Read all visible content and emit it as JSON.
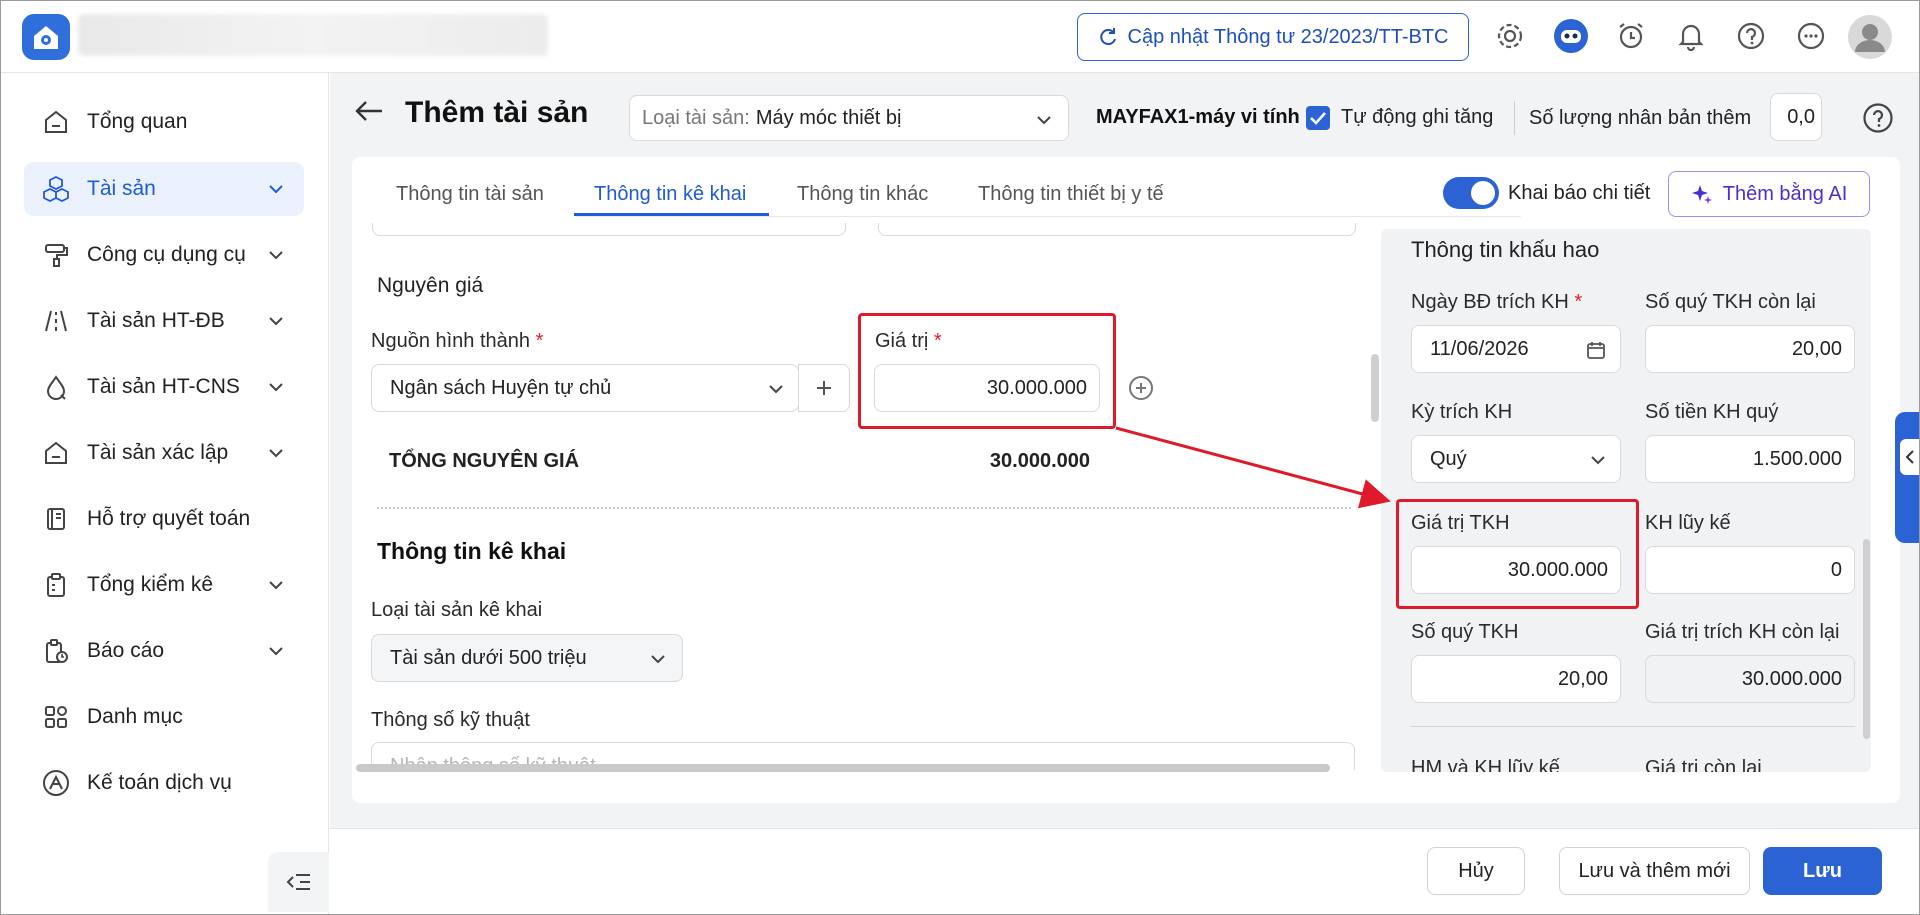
{
  "topbar": {
    "update_button": "Cập nhật Thông tư 23/2023/TT-BTC",
    "icons": [
      "settings-icon",
      "assistant-bot-icon",
      "alarm-icon",
      "bell-icon",
      "help-icon",
      "more-icon",
      "avatar"
    ]
  },
  "sidebar": {
    "items": [
      {
        "label": "Tổng quan",
        "icon": "home-icon"
      },
      {
        "label": "Tài sản",
        "icon": "cubes-icon"
      },
      {
        "label": "Công cụ dụng cụ",
        "icon": "paint-roller-icon"
      },
      {
        "label": "Tài sản HT-ĐB",
        "icon": "road-icon"
      },
      {
        "label": "Tài sản HT-CNS",
        "icon": "water-drop-icon"
      },
      {
        "label": "Tài sản xác lập",
        "icon": "home-outline-icon"
      },
      {
        "label": "Hỗ trợ quyết toán",
        "icon": "book-icon"
      },
      {
        "label": "Tổng kiểm kê",
        "icon": "clipboard-icon"
      },
      {
        "label": "Báo cáo",
        "icon": "report-icon"
      },
      {
        "label": "Danh mục",
        "icon": "grid-icon"
      },
      {
        "label": "Kế toán dịch vụ",
        "icon": "accounting-icon"
      }
    ]
  },
  "header": {
    "title": "Thêm tài sản",
    "asset_type_label": "Loại tài sản:",
    "asset_type_value": "Máy móc thiết bị",
    "asset_code": "MAYFAX1-máy vi tính",
    "auto_increase": "Tự động ghi tăng",
    "duplicate_label": "Số lượng nhân bản thêm",
    "duplicate_value": "0,0"
  },
  "tabs": [
    "Thông tin tài sản",
    "Thông tin kê khai",
    "Thông tin khác",
    "Thông tin thiết bị y tế"
  ],
  "detail_toggle_label": "Khai báo chi tiết",
  "ai_button": "Thêm bằng AI",
  "original_cost": {
    "section_title": "Nguyên giá",
    "source_label": "Nguồn hình thành",
    "source_value": "Ngân sách Huyện tự chủ",
    "value_label": "Giá trị",
    "value": "30.000.000",
    "total_label": "TỔNG NGUYÊN GIÁ",
    "total_value": "30.000.000"
  },
  "declaration": {
    "section_title": "Thông tin kê khai",
    "type_label": "Loại tài sản kê khai",
    "type_value": "Tài sản dưới 500 triệu",
    "spec_label": "Thông số kỹ thuật",
    "spec_placeholder": "Nhập thông số kỹ thuật"
  },
  "depreciation": {
    "title": "Thông tin khấu hao",
    "start_date_label": "Ngày BĐ trích KH",
    "start_date": "11/06/2026",
    "remaining_quarters_label": "Số quý TKH còn lại",
    "remaining_quarters": "20,00",
    "period_label": "Kỳ trích KH",
    "period_value": "Quý",
    "quarter_amount_label": "Số tiền KH quý",
    "quarter_amount": "1.500.000",
    "dep_value_label": "Giá trị TKH",
    "dep_value": "30.000.000",
    "accumulated_label": "KH lũy kế",
    "accumulated": "0",
    "quarters_label": "Số quý TKH",
    "quarters": "20,00",
    "remaining_value_label": "Giá trị trích KH còn lại",
    "remaining_value": "30.000.000",
    "hm_label": "HM và KH lũy kế",
    "residual_label": "Giá trị còn lại"
  },
  "footer": {
    "cancel": "Hủy",
    "save_new": "Lưu và thêm mới",
    "save": "Lưu"
  },
  "colors": {
    "primary": "#2b63d4",
    "highlight": "#e0192b",
    "ai": "#7c3aed"
  }
}
